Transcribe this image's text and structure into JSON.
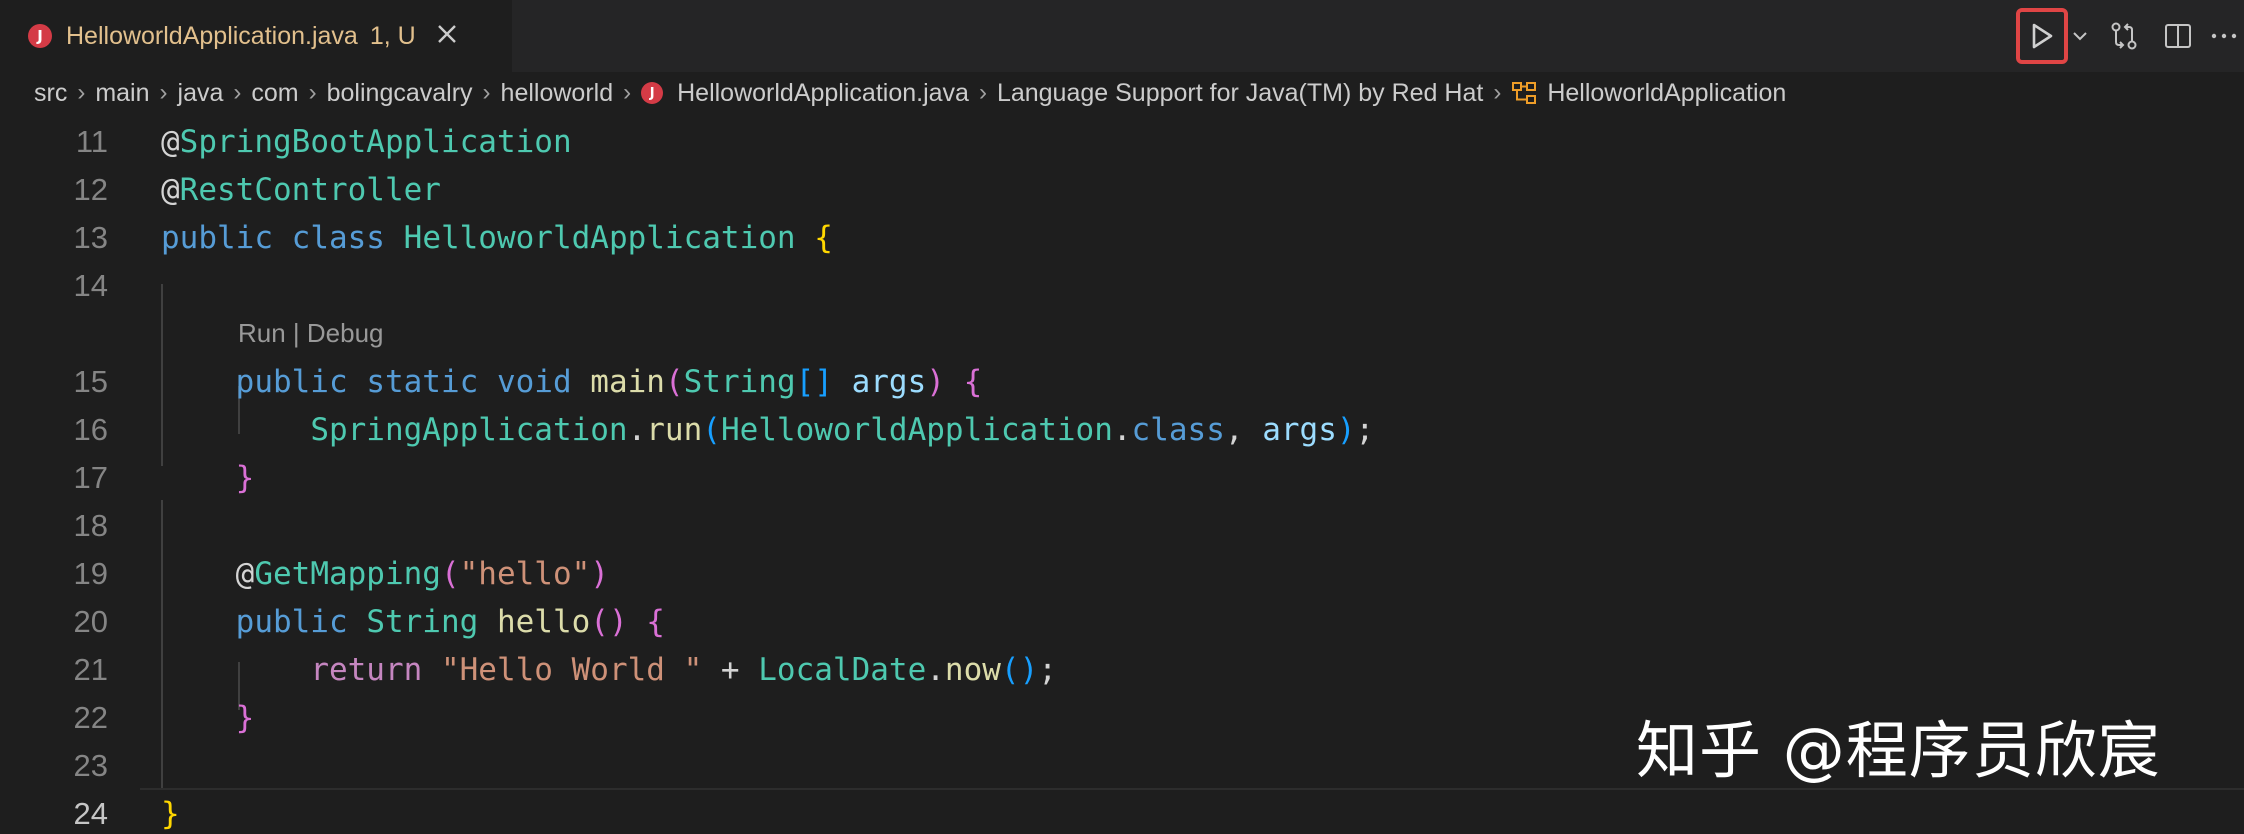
{
  "tab": {
    "title": "HelloworldApplication.java",
    "status": "1, U",
    "icon": "java-file-icon"
  },
  "actions": [
    "run-icon",
    "run-dropdown-icon",
    "source-control-compare-icon",
    "split-editor-icon",
    "more-actions-icon"
  ],
  "breadcrumb": [
    "src",
    "main",
    "java",
    "com",
    "bolingcavalry",
    "helloworld",
    "HelloworldApplication.java",
    "Language Support for Java(TM) by Red Hat",
    "HelloworldApplication"
  ],
  "code_lens": "Run | Debug",
  "lines": [
    {
      "n": "11",
      "tokens": [
        [
          "@",
          "at"
        ],
        [
          "SpringBootApplication",
          "ann"
        ]
      ]
    },
    {
      "n": "12",
      "tokens": [
        [
          "@",
          "at"
        ],
        [
          "RestController",
          "ann"
        ]
      ]
    },
    {
      "n": "13",
      "tokens": [
        [
          "public",
          "kw"
        ],
        [
          " ",
          "op"
        ],
        [
          "class",
          "kw"
        ],
        [
          " ",
          "op"
        ],
        [
          "HelloworldApplication",
          "cls"
        ],
        [
          " ",
          "op"
        ],
        [
          "{",
          "p1"
        ]
      ]
    },
    {
      "n": "14",
      "tokens": []
    },
    {
      "n": "15",
      "tokens": [
        [
          "    ",
          "op"
        ],
        [
          "public",
          "kw"
        ],
        [
          " ",
          "op"
        ],
        [
          "static",
          "kw"
        ],
        [
          " ",
          "op"
        ],
        [
          "void",
          "kw"
        ],
        [
          " ",
          "op"
        ],
        [
          "main",
          "fn"
        ],
        [
          "(",
          "p2"
        ],
        [
          "String",
          "cls"
        ],
        [
          "[]",
          "p3"
        ],
        [
          " ",
          "op"
        ],
        [
          "args",
          "var"
        ],
        [
          ")",
          "p2"
        ],
        [
          " ",
          "op"
        ],
        [
          "{",
          "p2"
        ]
      ]
    },
    {
      "n": "16",
      "tokens": [
        [
          "        ",
          "op"
        ],
        [
          "SpringApplication",
          "cls"
        ],
        [
          ".",
          "op"
        ],
        [
          "run",
          "fn"
        ],
        [
          "(",
          "p3"
        ],
        [
          "HelloworldApplication",
          "cls"
        ],
        [
          ".",
          "op"
        ],
        [
          "class",
          "kw"
        ],
        [
          ", ",
          "op"
        ],
        [
          "args",
          "var"
        ],
        [
          ")",
          "p3"
        ],
        [
          ";",
          "op"
        ]
      ]
    },
    {
      "n": "17",
      "tokens": [
        [
          "    ",
          "op"
        ],
        [
          "}",
          "p2"
        ]
      ]
    },
    {
      "n": "18",
      "tokens": []
    },
    {
      "n": "19",
      "tokens": [
        [
          "    ",
          "op"
        ],
        [
          "@",
          "at"
        ],
        [
          "GetMapping",
          "ann"
        ],
        [
          "(",
          "p2"
        ],
        [
          "\"hello\"",
          "str"
        ],
        [
          ")",
          "p2"
        ]
      ]
    },
    {
      "n": "20",
      "tokens": [
        [
          "    ",
          "op"
        ],
        [
          "public",
          "kw"
        ],
        [
          " ",
          "op"
        ],
        [
          "String",
          "cls"
        ],
        [
          " ",
          "op"
        ],
        [
          "hello",
          "fn"
        ],
        [
          "()",
          "p2"
        ],
        [
          " ",
          "op"
        ],
        [
          "{",
          "p2"
        ]
      ]
    },
    {
      "n": "21",
      "tokens": [
        [
          "        ",
          "op"
        ],
        [
          "return",
          "ctrl"
        ],
        [
          " ",
          "op"
        ],
        [
          "\"Hello World \"",
          "str"
        ],
        [
          " + ",
          "op"
        ],
        [
          "LocalDate",
          "cls"
        ],
        [
          ".",
          "op"
        ],
        [
          "now",
          "fn"
        ],
        [
          "()",
          "p3"
        ],
        [
          ";",
          "op"
        ]
      ]
    },
    {
      "n": "22",
      "tokens": [
        [
          "    ",
          "op"
        ],
        [
          "}",
          "p2"
        ]
      ]
    },
    {
      "n": "23",
      "tokens": []
    },
    {
      "n": "24",
      "tokens": [
        [
          "}",
          "p1"
        ]
      ]
    }
  ],
  "active_line": "24",
  "colors": {
    "background": "#1e1e1e",
    "tab_modified": "#e2c08d",
    "run_highlight": "#e04545",
    "keyword": "#569cd6",
    "type": "#4ec9b0",
    "function": "#dcdcaa",
    "variable": "#9cdcfe",
    "string": "#ce9178",
    "control": "#c586c0"
  },
  "watermark": "知乎 @程序员欣宸"
}
